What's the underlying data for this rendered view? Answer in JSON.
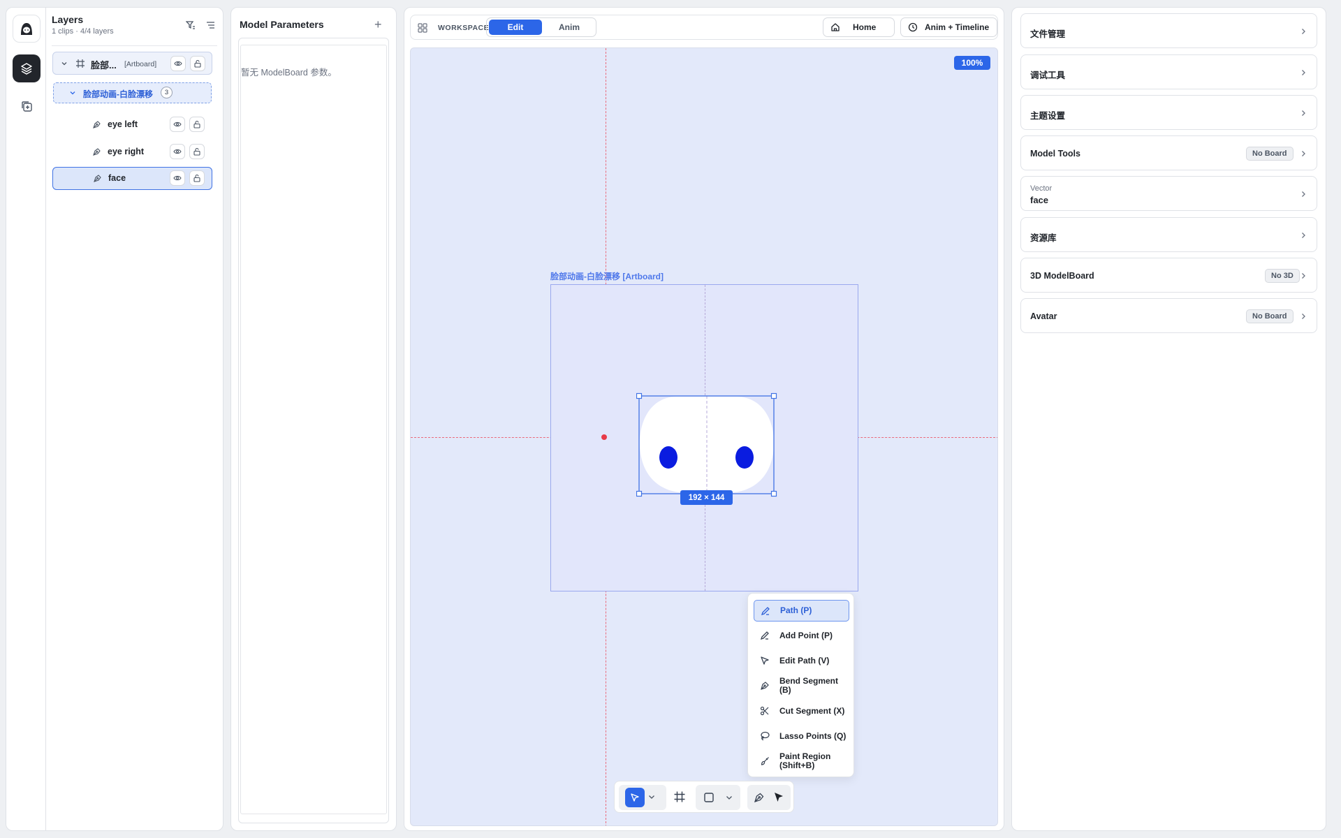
{
  "layers_panel": {
    "title": "Layers",
    "subtitle": "1 clips · 4/4 layers",
    "artboard": {
      "name": "脸部...",
      "tag": "[Artboard]"
    },
    "group": {
      "name": "脸部动画-白脸漂移",
      "count": "3"
    },
    "items": [
      {
        "name": "eye left"
      },
      {
        "name": "eye right"
      },
      {
        "name": "face",
        "selected": true
      }
    ]
  },
  "model_params": {
    "title": "Model Parameters",
    "add": "+",
    "empty": "暂无 ModelBoard 参数。"
  },
  "workspace": {
    "label": "WORKSPACE",
    "modes": [
      "Edit",
      "Anim"
    ],
    "active_mode": "Edit",
    "home": "Home",
    "anim_timeline": "Anim + Timeline",
    "zoom": "100%",
    "artboard_label": "脸部动画-白脸漂移 [Artboard]",
    "selection_size": "192 × 144",
    "colors": {
      "accent": "#2c66e8",
      "eye": "#0a1ce0",
      "face": "#ffffff",
      "guide": "#ea6a7c"
    }
  },
  "tool_menu": {
    "items": [
      {
        "label": "Path (P)",
        "active": true
      },
      {
        "label": "Add Point (P)"
      },
      {
        "label": "Edit Path (V)"
      },
      {
        "label": "Bend Segment (B)"
      },
      {
        "label": "Cut Segment (X)"
      },
      {
        "label": "Lasso Points (Q)"
      },
      {
        "label": "Paint Region (Shift+B)"
      }
    ]
  },
  "right_panel": {
    "cards": [
      {
        "title": "文件管理"
      },
      {
        "title": "调试工具"
      },
      {
        "title": "主题设置"
      },
      {
        "title": "Model Tools",
        "badge": "No Board"
      },
      {
        "subtitle": "Vector",
        "value": "face"
      },
      {
        "title": "资源库"
      },
      {
        "title": "3D ModelBoard",
        "badge": "No 3D"
      },
      {
        "title": "Avatar",
        "badge": "No Board"
      }
    ]
  }
}
